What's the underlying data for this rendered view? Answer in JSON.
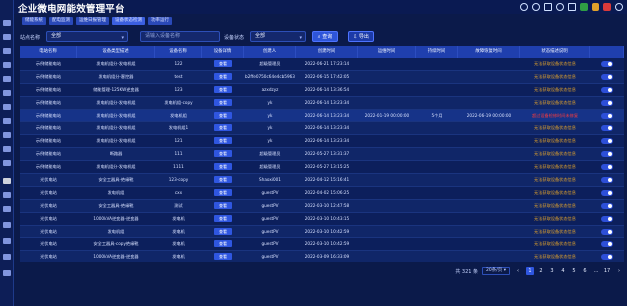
{
  "app": {
    "title": "企业微电网能效管理平台"
  },
  "tags": [
    "储能系统",
    "配电监测",
    "运维日报管理",
    "设备状态检测",
    "功率运行"
  ],
  "filters": {
    "site_label": "站点名称",
    "site_value": "全部",
    "device_placeholder": "请输入设备名称",
    "status_label": "设备状态",
    "status_value": "全部",
    "search_btn": "查询",
    "export_btn": "导出"
  },
  "columns": [
    "电站名称",
    "设备类型描述",
    "设备名称",
    "设备详情",
    "创建人",
    "创建时间",
    "运维时间",
    "持续时间",
    "故障恢复时间",
    "状态描述说明",
    ""
  ],
  "rows": [
    {
      "station": "示例储能电站",
      "type": "发电机组分-发电机组",
      "name": "122",
      "creator": "超级管理员",
      "created": "2022-06-21 17:23:14",
      "ops": "",
      "dur": "",
      "recov": "",
      "status": "无法获取设备状态信息",
      "red": false
    },
    {
      "station": "示例储能电站",
      "type": "发电机组分-客控器",
      "name": "test",
      "creator": "b2ffe0750c64e4cb5963",
      "created": "2022-06-15 17:42:05",
      "ops": "",
      "dur": "",
      "recov": "",
      "status": "无法获取设备状态信息",
      "red": false
    },
    {
      "station": "示例储能电站",
      "type": "储能管理-125KW逆变器",
      "name": "123",
      "creator": "azxdzyz",
      "created": "2022-06-14 13:36:54",
      "ops": "",
      "dur": "",
      "recov": "",
      "status": "无法获取设备状态信息",
      "red": false
    },
    {
      "station": "示例储能电站",
      "type": "发电机组分-发电机组",
      "name": "发电机组-copy",
      "creator": "yk",
      "created": "2022-06-14 13:23:34",
      "ops": "",
      "dur": "",
      "recov": "",
      "status": "无法获取设备状态信息",
      "red": false
    },
    {
      "station": "示例储能电站",
      "type": "发电机组分-发电机组",
      "name": "发电机组",
      "creator": "yk",
      "created": "2022-06-14 13:23:34",
      "ops": "2022-01-19 00:00:00",
      "dur": "5个月",
      "recov": "2022-06-19 00:00:00",
      "status": "超过设备检修时间未修复",
      "red": true
    },
    {
      "station": "示例储能电站",
      "type": "发电机组分-发电机组",
      "name": "发电机组1",
      "creator": "yk",
      "created": "2022-06-14 13:23:34",
      "ops": "",
      "dur": "",
      "recov": "",
      "status": "无法获取设备状态信息",
      "red": false
    },
    {
      "station": "示例储能电站",
      "type": "发电机组分-发电机组",
      "name": "121",
      "creator": "yk",
      "created": "2022-06-14 13:23:34",
      "ops": "",
      "dur": "",
      "recov": "",
      "status": "无法获取设备状态信息",
      "red": false
    },
    {
      "station": "示例储能电站",
      "type": "断路器",
      "name": "111",
      "creator": "超级管理员",
      "created": "2022-05-27 13:31:37",
      "ops": "",
      "dur": "",
      "recov": "",
      "status": "无法获取设备状态信息",
      "red": false
    },
    {
      "station": "示例储能电站",
      "type": "发电机组分-发电机组",
      "name": "1111",
      "creator": "超级管理员",
      "created": "2022-05-27 13:15:25",
      "ops": "",
      "dur": "",
      "recov": "",
      "status": "无法获取设备状态信息",
      "red": false
    },
    {
      "station": "光伏电站",
      "type": "安全工器具-绝缘靴",
      "name": "123-copy",
      "creator": "Shaoxi001",
      "created": "2022-04-12 15:16:41",
      "ops": "",
      "dur": "",
      "recov": "",
      "status": "无法获取设备状态信息",
      "red": false
    },
    {
      "station": "光伏电站",
      "type": "发电机组",
      "name": "cxx",
      "creator": "guestPV",
      "created": "2022-04-02 15:06:25",
      "ops": "",
      "dur": "",
      "recov": "",
      "status": "无法获取设备状态信息",
      "red": false
    },
    {
      "station": "光伏电站",
      "type": "安全工器具-绝缘靴",
      "name": "测试",
      "creator": "guestPV",
      "created": "2022-03-10 12:47:58",
      "ops": "",
      "dur": "",
      "recov": "",
      "status": "无法获取设备状态信息",
      "red": false
    },
    {
      "station": "光伏电站",
      "type": "1000kVA逆变器-逆变器",
      "name": "发电机",
      "creator": "guestPV",
      "created": "2022-03-10 10:43:15",
      "ops": "",
      "dur": "",
      "recov": "",
      "status": "无法获取设备状态信息",
      "red": false
    },
    {
      "station": "光伏电站",
      "type": "发电机组",
      "name": "发电机",
      "creator": "guestPV",
      "created": "2022-03-10 10:42:59",
      "ops": "",
      "dur": "",
      "recov": "",
      "status": "无法获取设备状态信息",
      "red": false
    },
    {
      "station": "光伏电站",
      "type": "安全工器具-copy绝缘靴",
      "name": "发电机",
      "creator": "guestPV",
      "created": "2022-03-10 10:42:59",
      "ops": "",
      "dur": "",
      "recov": "",
      "status": "无法获取设备状态信息",
      "red": false
    },
    {
      "station": "光伏电站",
      "type": "1000kVA逆变器-逆变器",
      "name": "发电机",
      "creator": "guestPV",
      "created": "2022-03-09 16:33:09",
      "ops": "",
      "dur": "",
      "recov": "",
      "status": "无法获取设备状态信息",
      "red": false
    }
  ],
  "row_action": "查看",
  "pager": {
    "total": "共 321 条",
    "size": "20条/页",
    "pages": [
      "1",
      "2",
      "3",
      "4",
      "5",
      "6",
      "...",
      "17"
    ],
    "current": "1"
  }
}
